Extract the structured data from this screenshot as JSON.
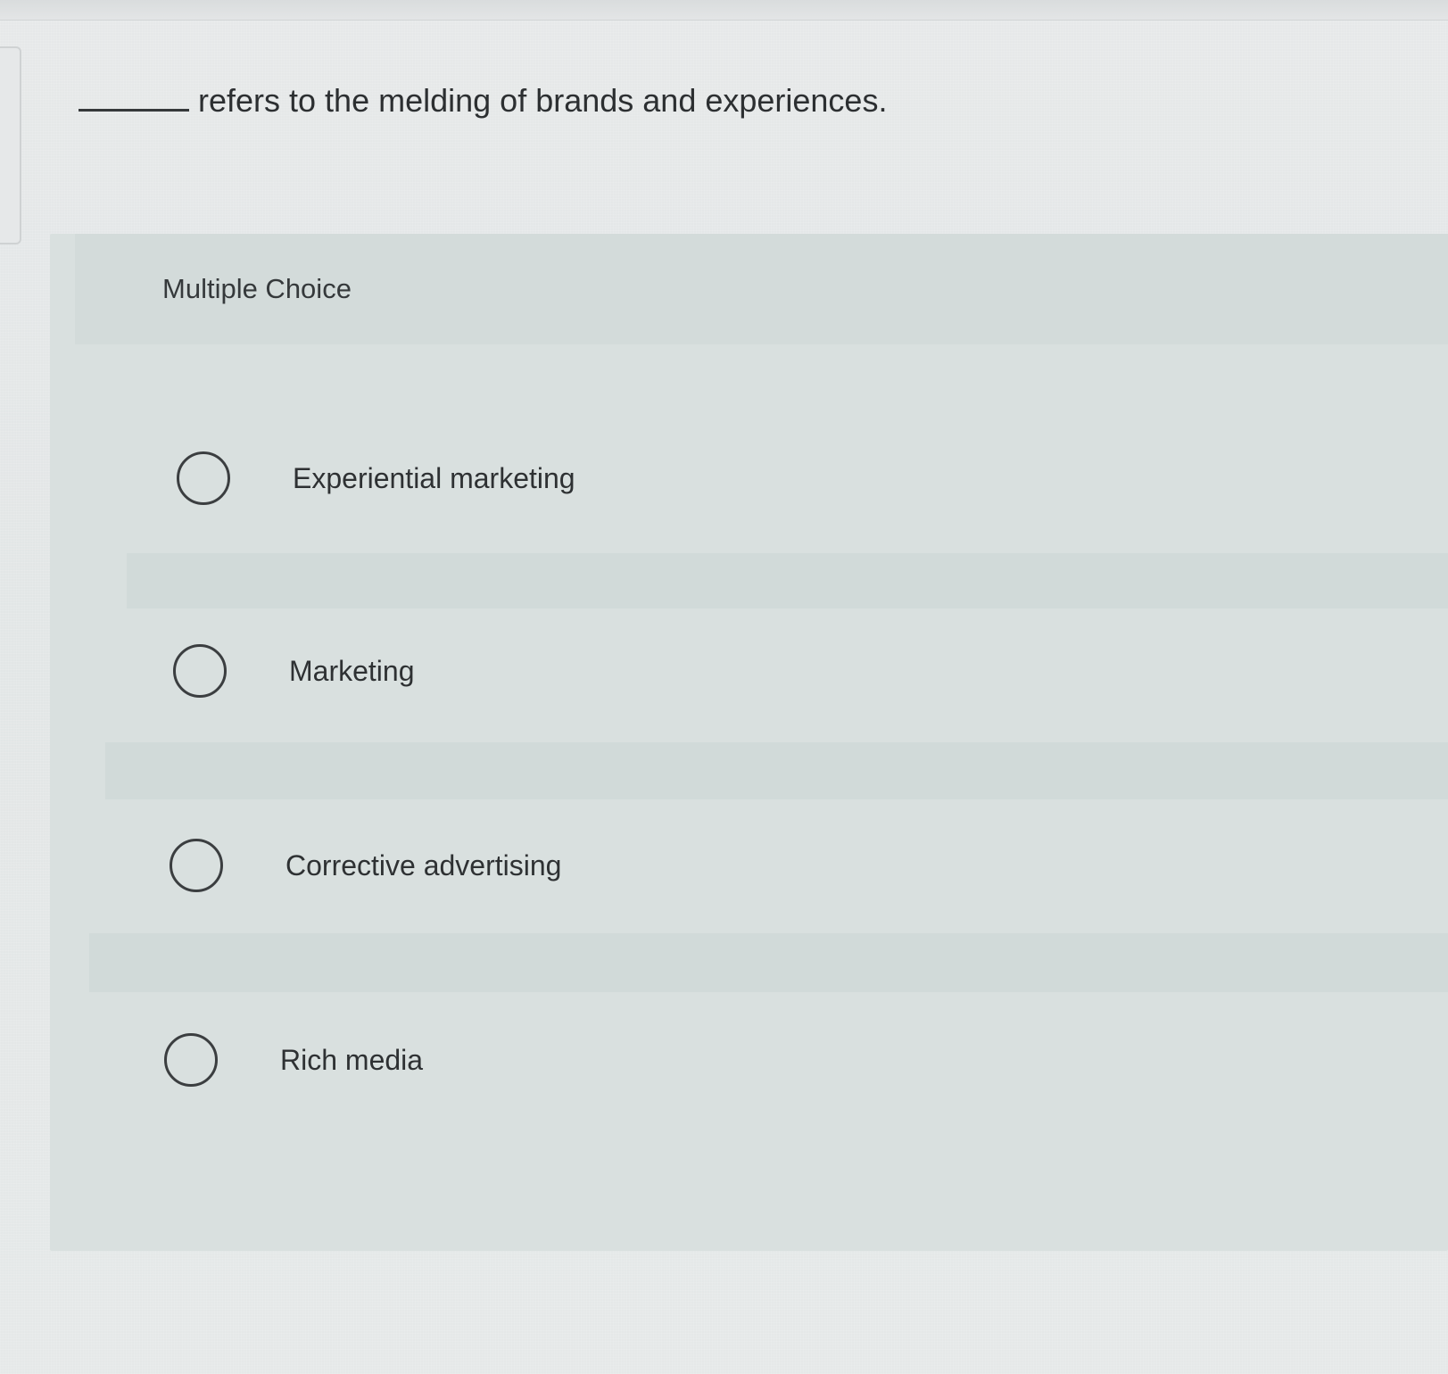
{
  "question": {
    "text": "refers to the melding of brands and experiences."
  },
  "panel": {
    "title": "Multiple Choice"
  },
  "options": [
    {
      "label": "Experiential marketing",
      "selected": false
    },
    {
      "label": "Marketing",
      "selected": false
    },
    {
      "label": "Corrective advertising",
      "selected": false
    },
    {
      "label": "Rich media",
      "selected": false
    }
  ]
}
